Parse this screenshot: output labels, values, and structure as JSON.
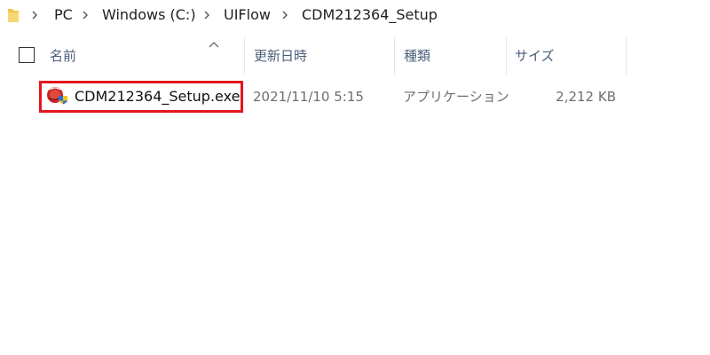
{
  "breadcrumb": {
    "items": [
      "PC",
      "Windows (C:)",
      "UIFlow",
      "CDM212364_Setup"
    ]
  },
  "columns": {
    "name": "名前",
    "date_modified": "更新日時",
    "type": "種類",
    "size": "サイズ"
  },
  "files": [
    {
      "name": "CDM212364_Setup.exe",
      "date_modified": "2021/11/10 5:15",
      "type": "アプリケーション",
      "size": "2,212 KB",
      "icon": "installer-shield-icon",
      "highlighted": true
    }
  ],
  "colors": {
    "highlight_border": "#e3161d",
    "header_text": "#4c607a",
    "folder_yellow": "#f5c64a"
  }
}
